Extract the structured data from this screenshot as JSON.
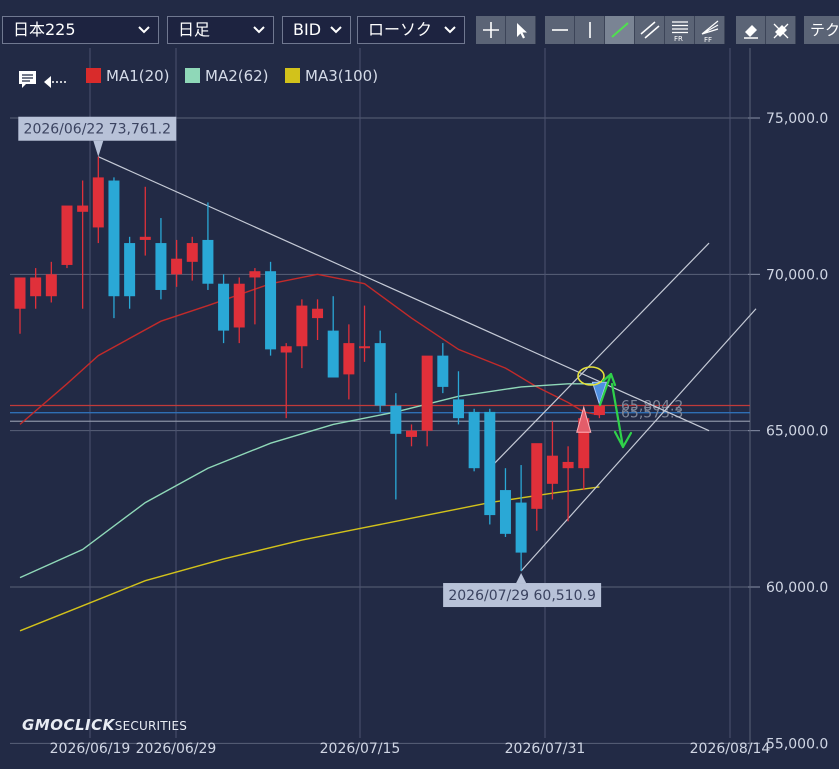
{
  "toolbar": {
    "symbol": "日本225",
    "period": "日足",
    "price_side": "BID",
    "chart_kind": "ローソク",
    "tech_tab": "テク"
  },
  "legend": [
    {
      "name": "MA1(20)",
      "color": "#d92b2b"
    },
    {
      "name": "MA2(62)",
      "color": "#8fd8b8"
    },
    {
      "name": "MA3(100)",
      "color": "#d2c21b"
    }
  ],
  "logo": {
    "brand": "GMOCLICK",
    "suffix": "SECURITIES"
  },
  "colors": {
    "up": "#e0303a",
    "down": "#2aa8d6",
    "background": "#222a45"
  },
  "chart_data": {
    "type": "candlestick",
    "title": "",
    "y_ticks": [
      "75,000.0",
      "70,000.0",
      "65,000.0",
      "60,000.0",
      "55,000.0"
    ],
    "ylim": [
      55000,
      76500
    ],
    "x_ticks": [
      "2026/06/19",
      "2026/06/29",
      "2026/07/15",
      "2026/07/31",
      "2026/08/14"
    ],
    "candles": [
      {
        "o": 68900,
        "h": 69200,
        "l": 68100,
        "c": 69900
      },
      {
        "o": 69300,
        "h": 70200,
        "l": 68900,
        "c": 69900
      },
      {
        "o": 69300,
        "h": 70400,
        "l": 69100,
        "c": 70000
      },
      {
        "o": 70300,
        "h": 72100,
        "l": 70200,
        "c": 72200
      },
      {
        "o": 72000,
        "h": 73000,
        "l": 68900,
        "c": 72200
      },
      {
        "o": 71500,
        "h": 73761.2,
        "l": 71000,
        "c": 73100
      },
      {
        "o": 73000,
        "h": 73100,
        "l": 68600,
        "c": 69300
      },
      {
        "o": 71000,
        "h": 71200,
        "l": 68900,
        "c": 69300
      },
      {
        "o": 71100,
        "h": 72800,
        "l": 70600,
        "c": 71200
      },
      {
        "o": 71000,
        "h": 71800,
        "l": 69200,
        "c": 69500
      },
      {
        "o": 70000,
        "h": 71100,
        "l": 69600,
        "c": 70500
      },
      {
        "o": 70400,
        "h": 71200,
        "l": 69800,
        "c": 71000
      },
      {
        "o": 71100,
        "h": 72300,
        "l": 69500,
        "c": 69700
      },
      {
        "o": 69700,
        "h": 70000,
        "l": 67800,
        "c": 68200
      },
      {
        "o": 68300,
        "h": 69900,
        "l": 67800,
        "c": 69700
      },
      {
        "o": 69900,
        "h": 70200,
        "l": 68400,
        "c": 70100
      },
      {
        "o": 70100,
        "h": 70400,
        "l": 67400,
        "c": 67600
      },
      {
        "o": 67500,
        "h": 67800,
        "l": 65400,
        "c": 67700
      },
      {
        "o": 67700,
        "h": 69200,
        "l": 67000,
        "c": 69000
      },
      {
        "o": 68600,
        "h": 69200,
        "l": 67900,
        "c": 68900
      },
      {
        "o": 68200,
        "h": 69300,
        "l": 66900,
        "c": 66700
      },
      {
        "o": 66800,
        "h": 68400,
        "l": 66000,
        "c": 67800
      },
      {
        "o": 67700,
        "h": 69000,
        "l": 67200,
        "c": 67700
      },
      {
        "o": 67800,
        "h": 68200,
        "l": 65600,
        "c": 65800
      },
      {
        "o": 65800,
        "h": 66200,
        "l": 62800,
        "c": 64900
      },
      {
        "o": 64800,
        "h": 65200,
        "l": 64500,
        "c": 65000
      },
      {
        "o": 65000,
        "h": 67300,
        "l": 64500,
        "c": 67400
      },
      {
        "o": 67400,
        "h": 67800,
        "l": 66200,
        "c": 66400
      },
      {
        "o": 66000,
        "h": 66900,
        "l": 65200,
        "c": 65400
      },
      {
        "o": 65600,
        "h": 65700,
        "l": 63700,
        "c": 63800
      },
      {
        "o": 65600,
        "h": 65700,
        "l": 62000,
        "c": 62300
      },
      {
        "o": 63100,
        "h": 63800,
        "l": 61600,
        "c": 61700
      },
      {
        "o": 62700,
        "h": 63900,
        "l": 60510.9,
        "c": 61100
      },
      {
        "o": 62500,
        "h": 63000,
        "l": 61800,
        "c": 64600
      },
      {
        "o": 63300,
        "h": 65300,
        "l": 62800,
        "c": 64200
      },
      {
        "o": 63800,
        "h": 64500,
        "l": 62100,
        "c": 64000
      },
      {
        "o": 63800,
        "h": 65400,
        "l": 63100,
        "c": 65400
      },
      {
        "o": 65500,
        "h": 65800,
        "l": 65400,
        "c": 65800
      }
    ],
    "moving_averages": [
      {
        "name": "MA1(20)",
        "color": "#c22a2a",
        "points": [
          [
            0,
            65200
          ],
          [
            3,
            66500
          ],
          [
            5,
            67400
          ],
          [
            9,
            68500
          ],
          [
            12,
            69000
          ],
          [
            16,
            69700
          ],
          [
            19,
            70000
          ],
          [
            22,
            69700
          ],
          [
            25,
            68600
          ],
          [
            28,
            67600
          ],
          [
            31,
            67000
          ],
          [
            33,
            66400
          ],
          [
            35,
            65900
          ],
          [
            36,
            65600
          ],
          [
            37,
            65500
          ]
        ]
      },
      {
        "name": "MA2(62)",
        "color": "#8fd8b8",
        "points": [
          [
            0,
            60300
          ],
          [
            4,
            61200
          ],
          [
            8,
            62700
          ],
          [
            12,
            63800
          ],
          [
            16,
            64600
          ],
          [
            20,
            65200
          ],
          [
            24,
            65600
          ],
          [
            28,
            66100
          ],
          [
            32,
            66400
          ],
          [
            35,
            66500
          ],
          [
            37,
            66500
          ]
        ]
      },
      {
        "name": "MA3(100)",
        "color": "#d2c21b",
        "points": [
          [
            0,
            58600
          ],
          [
            4,
            59400
          ],
          [
            8,
            60200
          ],
          [
            13,
            60900
          ],
          [
            18,
            61500
          ],
          [
            22,
            61900
          ],
          [
            26,
            62300
          ],
          [
            30,
            62700
          ],
          [
            34,
            63000
          ],
          [
            37,
            63200
          ]
        ]
      }
    ],
    "horizontal_levels": [
      {
        "value": 65804.2,
        "label": "65,804.2",
        "color": "#c13a3a"
      },
      {
        "value": 65575.3,
        "label": "65,575.3",
        "color": "#2f6fb5"
      },
      {
        "value": 65300,
        "label": "",
        "color": "#8a92a4"
      }
    ],
    "trendlines": [
      {
        "from": [
          5,
          73761.2
        ],
        "to": [
          37,
          67100
        ],
        "extend_to": [
          44,
          65000
        ]
      },
      {
        "from": [
          32,
          60510.9
        ],
        "to": [
          44,
          64700
        ],
        "extend_to": [
          47,
          68900
        ]
      },
      {
        "from": [
          30,
          63800
        ],
        "to": [
          44,
          71000
        ],
        "extend_to": null
      }
    ],
    "price_labels": [
      {
        "date": "2026/06/22",
        "value": "73,761.2"
      },
      {
        "date": "2026/07/29",
        "value": "60,510.9"
      }
    ]
  }
}
